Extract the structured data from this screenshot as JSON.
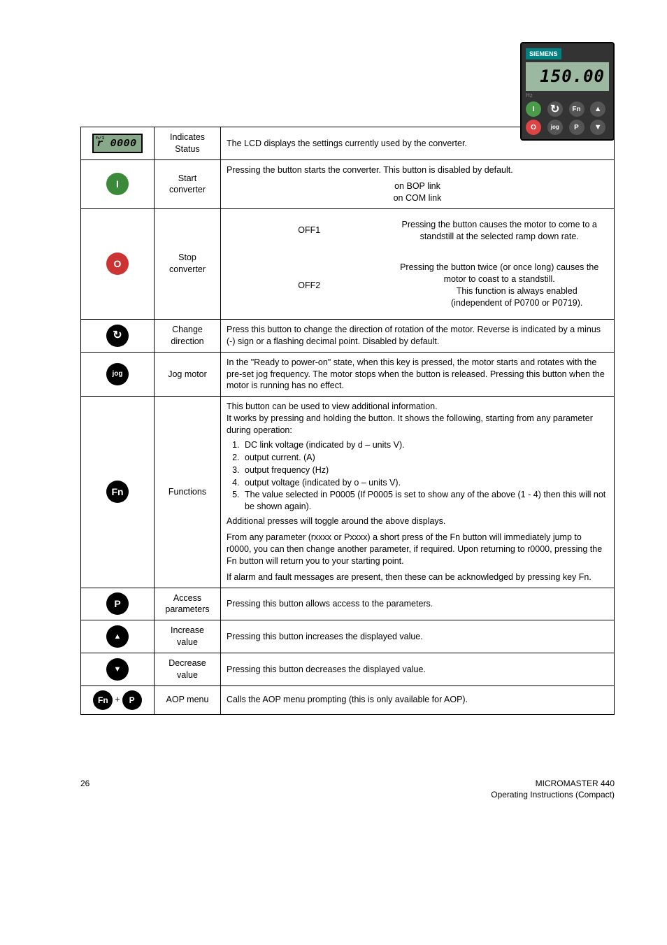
{
  "panel": {
    "brand": "SIEMENS",
    "lcd_value": "150.00",
    "hz_label": "Hz"
  },
  "rows": {
    "status": {
      "icon_label": "r 0000",
      "fn": "Indicates Status",
      "desc": "The LCD displays the settings currently used by the converter."
    },
    "start": {
      "fn": "Start converter",
      "desc": "Pressing the button starts the converter. This button is disabled by default.",
      "bop": "on BOP link",
      "com": "on COM link"
    },
    "stop": {
      "fn": "Stop converter",
      "off1_label": "OFF1",
      "off1_desc": "Pressing the button causes the motor to come to a standstill at the selected ramp down rate.",
      "off2_label": "OFF2",
      "off2_desc": "Pressing the button twice (or once long) causes the motor to coast to a standstill.",
      "note1": "This function is always enabled",
      "note2": "(independent of P0700 or P0719)."
    },
    "change": {
      "fn": "Change direction",
      "desc": "Press this button to change the direction of rotation of the motor. Reverse is indicated by a minus (-) sign or a flashing decimal point. Disabled by default."
    },
    "jog": {
      "fn": "Jog motor",
      "desc": "In the \"Ready to power-on\" state, when this key is pressed, the motor starts and rotates with the pre-set jog frequency. The motor stops when the button is released. Pressing this button when the motor is running has no effect."
    },
    "functions": {
      "fn": "Functions",
      "p1": "This button can be used to view additional information.",
      "p2": "It works by pressing and holding the button. It shows the following, starting from any parameter during operation:",
      "li1": "DC link voltage (indicated by d – units V).",
      "li2": "output current. (A)",
      "li3": "output frequency (Hz)",
      "li4": "output voltage (indicated by o – units V).",
      "li5": "The value selected in P0005 (If P0005 is set to show any of the above (1 - 4) then this will not be shown again).",
      "p3": "Additional presses will toggle around the above displays.",
      "p4": "From any parameter (rxxxx or Pxxxx) a short press of the Fn button will immediately jump to r0000, you can then change another parameter, if required. Upon returning to r0000, pressing the Fn button will return you to your starting point.",
      "p5": "If alarm and fault messages are present, then these can be acknowledged by pressing key Fn."
    },
    "access": {
      "fn": "Access parameters",
      "desc": "Pressing this button allows access to the parameters."
    },
    "increase": {
      "fn": "Increase value",
      "desc": "Pressing this button increases the displayed value."
    },
    "decrease": {
      "fn": "Decrease value",
      "desc": "Pressing this button decreases the displayed value."
    },
    "aop": {
      "fn": "AOP menu",
      "desc": "Calls the AOP menu prompting  (this is only available for AOP)."
    }
  },
  "footer": {
    "page": "26",
    "line1": "MICROMASTER 440",
    "line2": "Operating Instructions (Compact)"
  }
}
